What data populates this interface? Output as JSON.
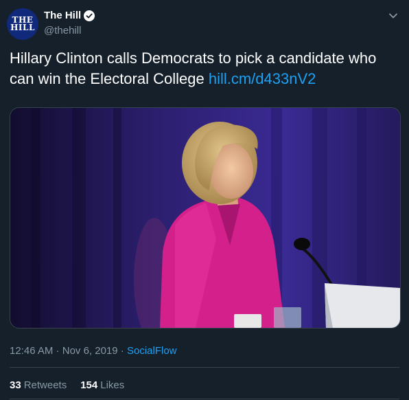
{
  "author": {
    "logo_line1": "THE",
    "logo_line2": "HILL",
    "name": "The Hill",
    "handle": "@thehill",
    "verified": true
  },
  "tweet": {
    "text": "Hillary Clinton calls Democrats to pick a candidate who can win the Electoral College",
    "link": "hill.cm/d433nV2"
  },
  "media": {
    "type": "photo"
  },
  "meta": {
    "time": "12:46 AM",
    "sep1": " · ",
    "date": "Nov 6, 2019",
    "sep2": " · ",
    "source": "SocialFlow"
  },
  "stats": {
    "retweets_count": "33",
    "retweets_label": "Retweets",
    "likes_count": "154",
    "likes_label": "Likes"
  },
  "icons": {
    "verified": "verified-badge-icon",
    "more": "chevron-down-icon"
  },
  "colors": {
    "background": "#15202b",
    "accent": "#1da1f2",
    "secondary_text": "#8899a6",
    "avatar_bg": "#10297a"
  }
}
